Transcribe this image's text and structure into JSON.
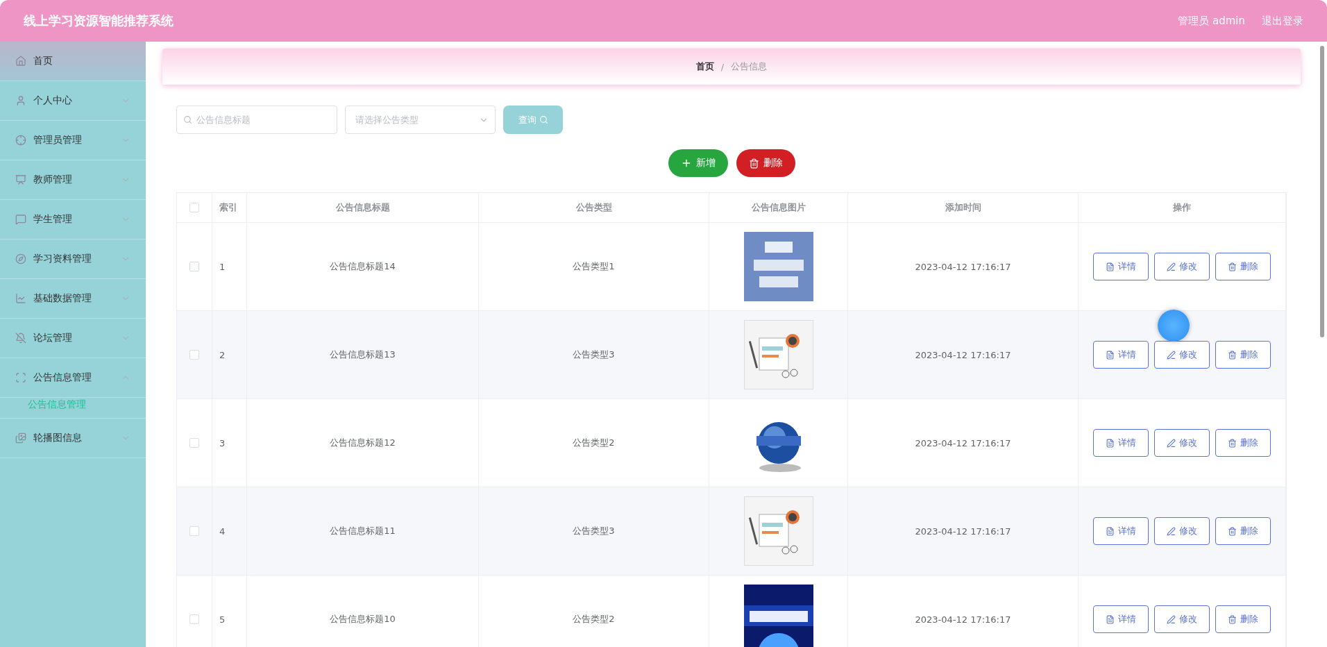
{
  "header": {
    "title": "线上学习资源智能推荐系统",
    "user": "管理员 admin",
    "logout": "退出登录"
  },
  "sidebar": {
    "items": [
      {
        "label": "首页",
        "kind": "link"
      },
      {
        "label": "个人中心",
        "kind": "menu",
        "expanded": false
      },
      {
        "label": "管理员管理",
        "kind": "menu",
        "expanded": false
      },
      {
        "label": "教师管理",
        "kind": "menu",
        "expanded": false
      },
      {
        "label": "学生管理",
        "kind": "menu",
        "expanded": false
      },
      {
        "label": "学习资料管理",
        "kind": "menu",
        "expanded": false
      },
      {
        "label": "基础数据管理",
        "kind": "menu",
        "expanded": false
      },
      {
        "label": "论坛管理",
        "kind": "menu",
        "expanded": false
      },
      {
        "label": "公告信息管理",
        "kind": "menu",
        "expanded": true,
        "children": [
          {
            "label": "公告信息管理",
            "selected": true
          }
        ]
      },
      {
        "label": "轮播图信息",
        "kind": "menu",
        "expanded": false
      }
    ]
  },
  "breadcrumb": [
    "首页",
    "/",
    "公告信息"
  ],
  "search": {
    "title_placeholder": "公告信息标题",
    "type_placeholder": "请选择公告类型",
    "button": "查询"
  },
  "actions": {
    "add": "新增",
    "delete": "删除"
  },
  "table": {
    "header_checked": false,
    "columns": [
      "索引",
      "公告信息标题",
      "公告类型",
      "公告信息图片",
      "添加时间",
      "操作"
    ],
    "rows": [
      {
        "checked": false,
        "index": "1",
        "title": "公告信息标题14",
        "type": "公告类型1",
        "time": "2023-04-12 17:16:17",
        "buttons": [
          "详情",
          "修改",
          "删除"
        ]
      },
      {
        "checked": false,
        "index": "2",
        "title": "公告信息标题13",
        "type": "公告类型3",
        "time": "2023-04-12 17:16:17",
        "buttons": [
          "详情",
          "修改",
          "删除"
        ]
      },
      {
        "checked": false,
        "index": "3",
        "title": "公告信息标题12",
        "type": "公告类型2",
        "time": "2023-04-12 17:16:17",
        "buttons": [
          "详情",
          "修改",
          "删除"
        ]
      },
      {
        "checked": false,
        "index": "4",
        "title": "公告信息标题11",
        "type": "公告类型3",
        "time": "2023-04-12 17:16:17",
        "buttons": [
          "详情",
          "修改",
          "删除"
        ]
      },
      {
        "checked": false,
        "index": "5",
        "title": "公告信息标题10",
        "type": "公告类型2",
        "time": "2023-04-12 17:16:17",
        "buttons": [
          "详情",
          "修改",
          "删除"
        ]
      }
    ]
  }
}
